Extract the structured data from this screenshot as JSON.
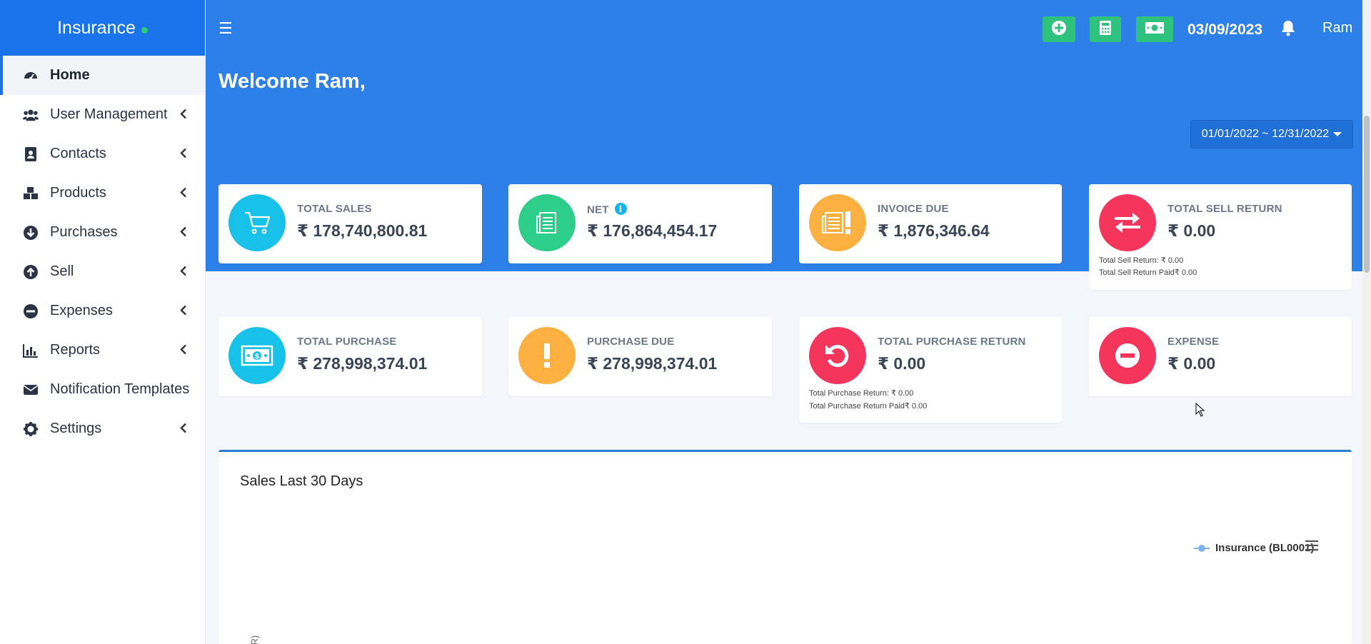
{
  "app": {
    "brand": "Insurance"
  },
  "sidebar": {
    "items": [
      {
        "label": "Home",
        "icon": "dashboard-icon"
      },
      {
        "label": "User Management",
        "icon": "users-icon"
      },
      {
        "label": "Contacts",
        "icon": "address-book-icon"
      },
      {
        "label": "Products",
        "icon": "cubes-icon"
      },
      {
        "label": "Purchases",
        "icon": "arrow-circle-down-icon"
      },
      {
        "label": "Sell",
        "icon": "arrow-circle-up-icon"
      },
      {
        "label": "Expenses",
        "icon": "minus-circle-icon"
      },
      {
        "label": "Reports",
        "icon": "bar-chart-icon"
      },
      {
        "label": "Notification Templates",
        "icon": "envelope-icon"
      },
      {
        "label": "Settings",
        "icon": "gear-icon"
      }
    ]
  },
  "topbar": {
    "menu_glyph": "☰",
    "date": "03/09/2023",
    "user": "Ram",
    "buttons": [
      "plus-circle-icon",
      "calculator-icon",
      "money-icon"
    ]
  },
  "hero": {
    "welcome": "Welcome Ram,",
    "date_range": "01/01/2022 ~ 12/31/2022"
  },
  "cards": {
    "total_sales": {
      "label": "TOTAL SALES",
      "value": "₹ 178,740,800.81",
      "color": "#17c1e8"
    },
    "net": {
      "label": "NET",
      "value": "₹ 176,864,454.17",
      "color": "#2dce89"
    },
    "invoice_due": {
      "label": "INVOICE DUE",
      "value": "₹ 1,876,346.64",
      "color": "#fbb040"
    },
    "total_sell_return": {
      "label": "TOTAL SELL RETURN",
      "value": "₹ 0.00",
      "color": "#f5365c",
      "sub1": "Total Sell Return: ₹ 0.00",
      "sub2": "Total Sell Return Paid₹ 0.00"
    },
    "total_purchase": {
      "label": "TOTAL PURCHASE",
      "value": "₹ 278,998,374.01",
      "color": "#17c1e8"
    },
    "purchase_due": {
      "label": "PURCHASE DUE",
      "value": "₹ 278,998,374.01",
      "color": "#fbb040"
    },
    "total_purchase_return": {
      "label": "TOTAL PURCHASE RETURN",
      "value": "₹ 0.00",
      "color": "#f5365c",
      "sub1": "Total Purchase Return: ₹ 0.00",
      "sub2": "Total Purchase Return Paid₹ 0.00"
    },
    "expense": {
      "label": "EXPENSE",
      "value": "₹ 0.00",
      "color": "#f5365c"
    }
  },
  "chart_panel": {
    "title": "Sales Last 30 Days",
    "legend": "Insurance (BL0001)",
    "y_axis_fragment": "IR)"
  }
}
